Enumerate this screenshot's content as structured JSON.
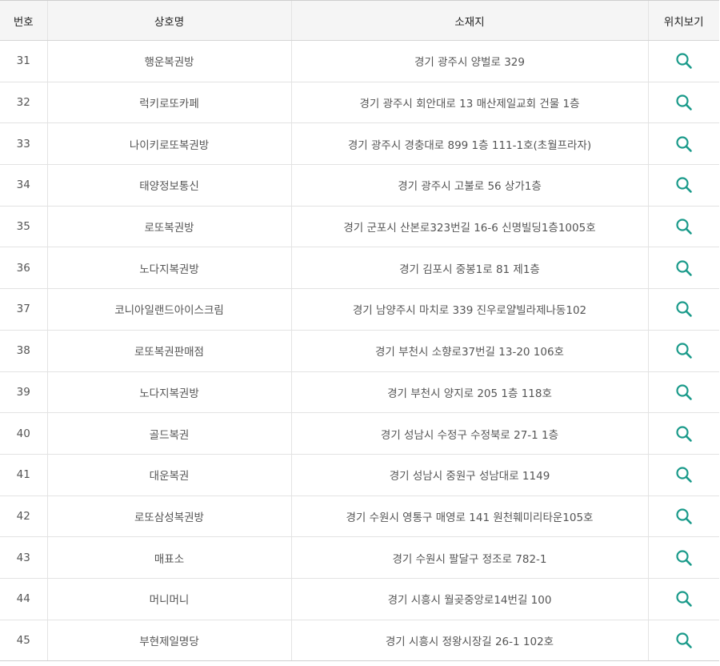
{
  "headers": {
    "number": "번호",
    "name": "상호명",
    "address": "소재지",
    "location": "위치보기"
  },
  "rows": [
    {
      "number": "31",
      "name": "행운복권방",
      "address": "경기 광주시 양벌로 329"
    },
    {
      "number": "32",
      "name": "럭키로또카페",
      "address": "경기 광주시 회안대로 13 매산제일교회 건물 1층"
    },
    {
      "number": "33",
      "name": "나이키로또복권방",
      "address": "경기 광주시 경충대로 899 1층 111-1호(초월프라자)"
    },
    {
      "number": "34",
      "name": "태양정보통신",
      "address": "경기 광주시 고불로 56 상가1층"
    },
    {
      "number": "35",
      "name": "로또복권방",
      "address": "경기 군포시 산본로323번길 16-6 신명빌딩1층1005호"
    },
    {
      "number": "36",
      "name": "노다지복권방",
      "address": "경기 김포시 중봉1로 81 제1층"
    },
    {
      "number": "37",
      "name": "코니아일랜드아이스크림",
      "address": "경기 남양주시 마치로 339 진우로얄빌라제나동102"
    },
    {
      "number": "38",
      "name": "로또복권판매점",
      "address": "경기 부천시 소향로37번길 13-20 106호"
    },
    {
      "number": "39",
      "name": "노다지복권방",
      "address": "경기 부천시 양지로 205 1층 118호"
    },
    {
      "number": "40",
      "name": "골드복권",
      "address": "경기 성남시 수정구 수정북로 27-1 1층"
    },
    {
      "number": "41",
      "name": "대운복권",
      "address": "경기 성남시 중원구 성남대로 1149"
    },
    {
      "number": "42",
      "name": "로또삼성복권방",
      "address": "경기 수원시 영통구 매영로 141 원천훼미리타운105호"
    },
    {
      "number": "43",
      "name": "매표소",
      "address": "경기 수원시 팔달구 정조로 782-1"
    },
    {
      "number": "44",
      "name": "머니머니",
      "address": "경기 시흥시 월곶중앙로14번길 100"
    },
    {
      "number": "45",
      "name": "부현제일명당",
      "address": "경기 시흥시 정왕시장길 26-1 102호"
    }
  ],
  "icon": {
    "name": "search-icon",
    "color": "#1a9a8a"
  }
}
